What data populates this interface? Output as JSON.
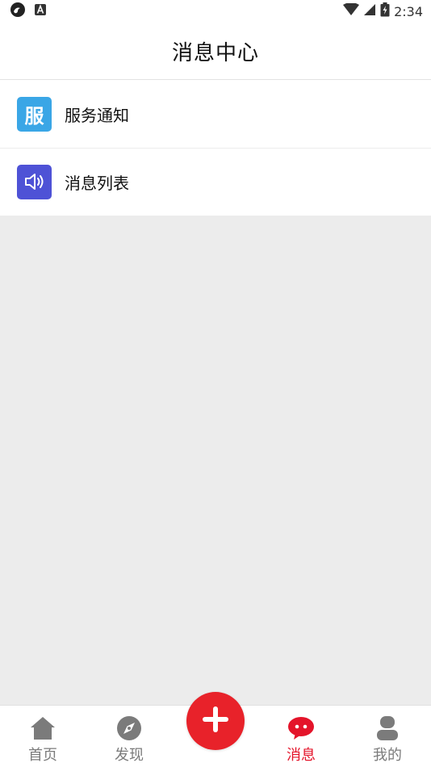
{
  "status_bar": {
    "time": "2:34",
    "icons": [
      "app-notification-icon",
      "a-notification-icon",
      "wifi-icon",
      "signal-icon",
      "battery-icon"
    ]
  },
  "header": {
    "title": "消息中心"
  },
  "list": {
    "items": [
      {
        "label": "服务通知",
        "icon": "service-icon",
        "icon_text": "服",
        "icon_color": "#3aa6e6"
      },
      {
        "label": "消息列表",
        "icon": "speaker-icon",
        "icon_color": "#4e52d6"
      }
    ]
  },
  "tabbar": {
    "tabs": [
      {
        "label": "首页",
        "icon": "home-icon",
        "active": false
      },
      {
        "label": "发现",
        "icon": "compass-icon",
        "active": false
      },
      {
        "label": "消息",
        "icon": "chat-icon",
        "active": true
      },
      {
        "label": "我的",
        "icon": "user-icon",
        "active": false
      }
    ],
    "fab_icon": "plus-icon",
    "active_color": "#e4142a",
    "inactive_color": "#7b7b7b"
  }
}
